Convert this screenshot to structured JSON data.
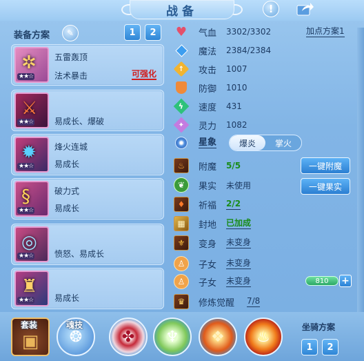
{
  "window": {
    "title": "战备"
  },
  "left": {
    "plan_title": "装备方案",
    "plan_buttons": [
      "1",
      "2"
    ],
    "cards": [
      {
        "name": "五雷轰顶",
        "sub": "法术暴击",
        "badge": "可强化",
        "stars": "★★☆"
      },
      {
        "name": "",
        "sub": "易成长、爆破",
        "badge": "",
        "stars": "★★☆"
      },
      {
        "name": "烽火连城",
        "sub": "易成长",
        "badge": "",
        "stars": "★★☆"
      },
      {
        "name": "破力式",
        "sub": "易成长",
        "badge": "",
        "stars": "★★☆"
      },
      {
        "name": "",
        "sub": "愤怒、易成长",
        "badge": "",
        "stars": "★★☆"
      },
      {
        "name": "",
        "sub": "易成长",
        "badge": "",
        "stars": "★★☆"
      }
    ]
  },
  "attrs": {
    "add_plan": "加点方案1",
    "items": [
      {
        "name": "气血",
        "value": "3302/3302",
        "icon": "heart-icon",
        "color": "#e4506b"
      },
      {
        "name": "魔法",
        "value": "2384/2384",
        "icon": "diamond-icon",
        "color": "#3d9ef0"
      },
      {
        "name": "攻击",
        "value": "1007",
        "icon": "sword-icon",
        "color": "#f2b430"
      },
      {
        "name": "防御",
        "value": "1010",
        "icon": "shield-icon",
        "color": "#f08a3a"
      },
      {
        "name": "速度",
        "value": "431",
        "icon": "bolt-icon",
        "color": "#2ec27a"
      },
      {
        "name": "灵力",
        "value": "1082",
        "icon": "sparkle-icon",
        "color": "#c47be0"
      }
    ],
    "star_label": "星象",
    "star_options": [
      "爆炎",
      "掌火"
    ]
  },
  "extras": {
    "rows": [
      {
        "name": "附魔",
        "value": "5/5",
        "style": "green",
        "icon": "enchant-icon"
      },
      {
        "name": "果实",
        "value": "未使用",
        "style": "plain",
        "icon": "fruit-icon"
      },
      {
        "name": "祈福",
        "value": "2/2",
        "style": "green-under",
        "icon": "bless-icon"
      },
      {
        "name": "封地",
        "value": "已加成",
        "style": "green-under",
        "icon": "fief-icon"
      },
      {
        "name": "变身",
        "value": "未变身",
        "style": "under",
        "icon": "transform-icon"
      },
      {
        "name": "子女",
        "value": "未变身",
        "style": "under",
        "icon": "child-icon"
      },
      {
        "name": "子女",
        "value": "未变身",
        "style": "under",
        "icon": "child-icon"
      },
      {
        "name": "修炼觉醒",
        "value": "7/8",
        "style": "under",
        "icon": "cultivate-icon"
      }
    ],
    "btn_enchant": "一键附魔",
    "btn_fruit": "一键果实",
    "exp_value": "810",
    "plus": "+"
  },
  "bottom": {
    "suit_label": "套装",
    "soul_label": "魂技",
    "mount_title": "坐骑方案",
    "mount_buttons": [
      "1",
      "2"
    ]
  }
}
